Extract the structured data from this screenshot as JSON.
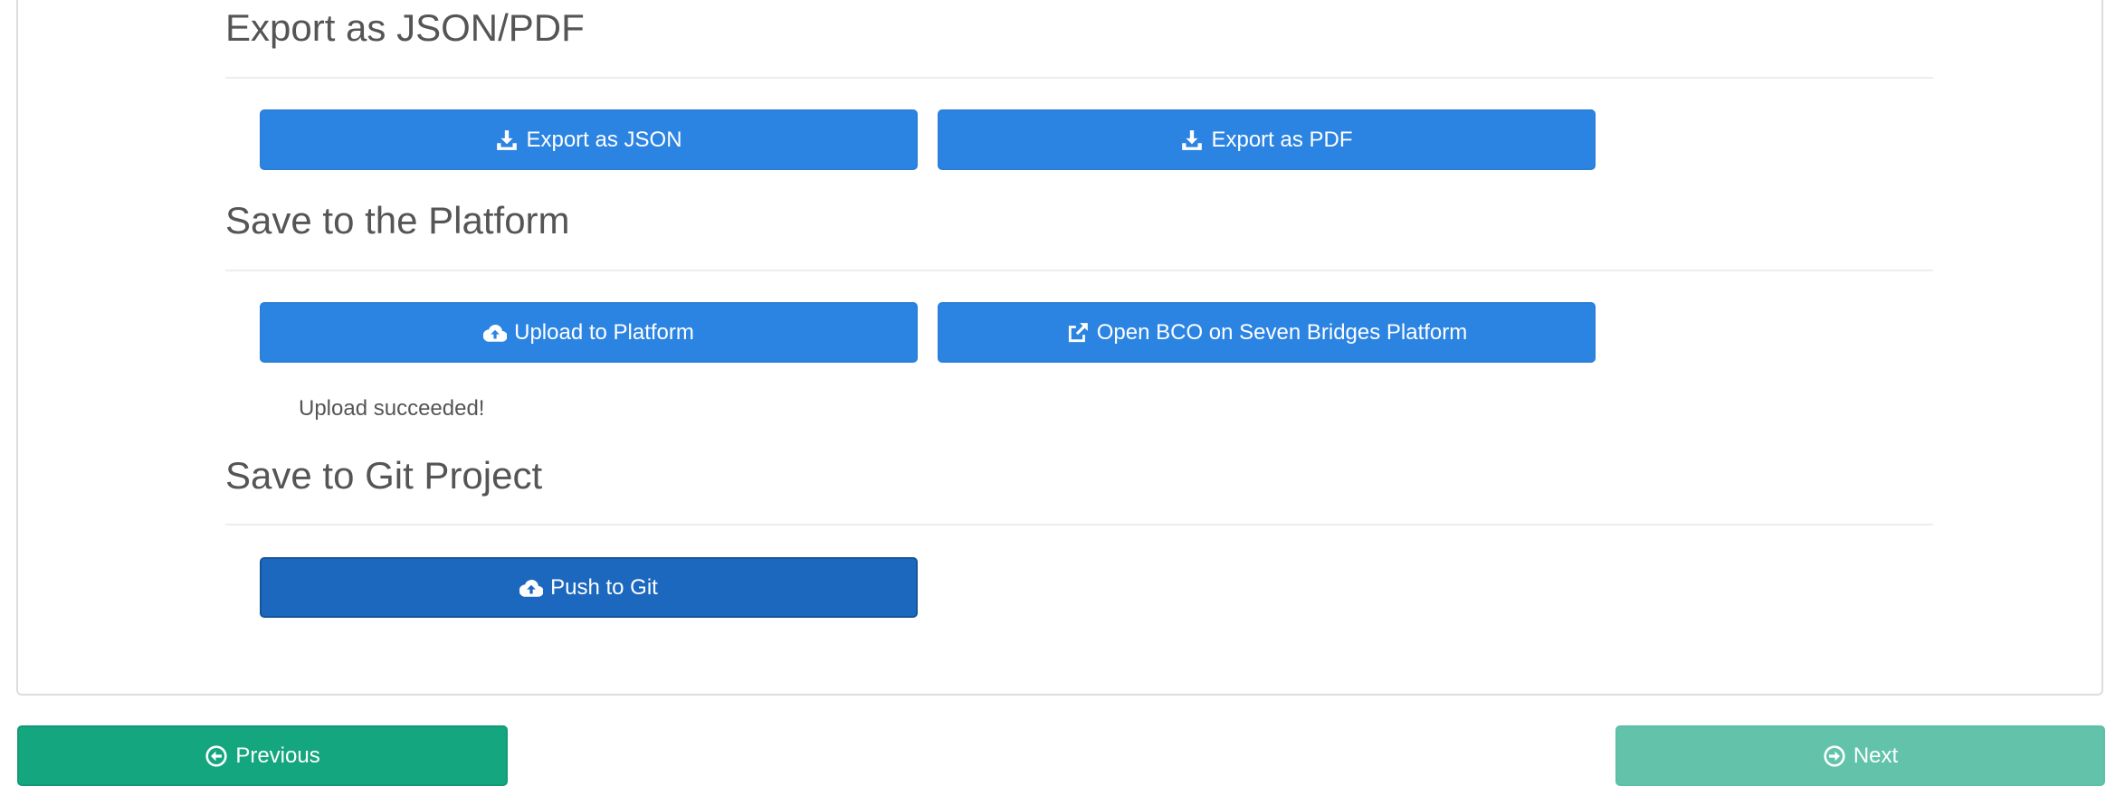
{
  "export": {
    "title": "Export as JSON/PDF",
    "json_label": "Export as JSON",
    "pdf_label": "Export as PDF"
  },
  "platform": {
    "title": "Save to the Platform",
    "upload_label": "Upload to Platform",
    "open_label": "Open BCO on Seven Bridges Platform",
    "status": "Upload succeeded!"
  },
  "git": {
    "title": "Save to Git Project",
    "push_label": "Push to Git"
  },
  "nav": {
    "previous_label": "Previous",
    "next_label": "Next"
  },
  "icons": {
    "export_json": "download-icon",
    "export_pdf": "download-icon",
    "upload": "cloud-upload-icon",
    "open": "external-link-icon",
    "push": "cloud-upload-icon",
    "previous": "circle-arrow-left-icon",
    "next": "circle-arrow-right-icon"
  },
  "colors": {
    "primary": "#2c84e2",
    "primary_active": "#1c68bf",
    "success": "#14a67f",
    "success_disabled": "#62c3aa"
  }
}
